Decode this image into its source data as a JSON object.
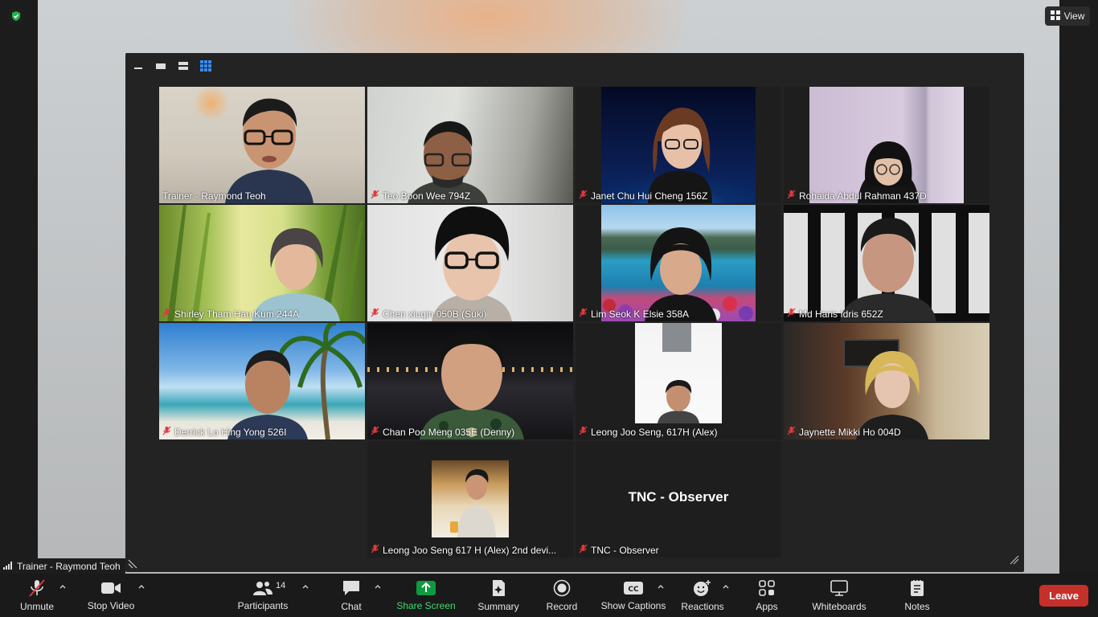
{
  "top": {
    "view_label": "View"
  },
  "gallery": {
    "observer_title": "TNC - Observer",
    "tiles": [
      {
        "name": "Trainer - Raymond Teoh",
        "muted": false
      },
      {
        "name": "Teo Boon Wee 794Z",
        "muted": true
      },
      {
        "name": "Janet Chu Hui Cheng 156Z",
        "muted": true
      },
      {
        "name": "Rohaida Abdul Rahman 437D",
        "muted": true
      },
      {
        "name": "Shirley Tham Hau Kum 244A",
        "muted": true
      },
      {
        "name": "Chen xiuqin 050B (Suki)",
        "muted": true
      },
      {
        "name": "Lim Seok K Elsie 358A",
        "muted": true
      },
      {
        "name": "Md Haris Idris 652Z",
        "muted": true
      },
      {
        "name": "Derrick Lo Hing Yong 526I",
        "muted": true
      },
      {
        "name": "Chan Poo Meng 035E (Denny)",
        "muted": true
      },
      {
        "name": "Leong Joo Seng, 617H (Alex)",
        "muted": true
      },
      {
        "name": "Jaynette Mikki Ho 004D",
        "muted": true
      },
      {
        "name": "Leong Joo Seng 617 H (Alex) 2nd devi...",
        "muted": true
      },
      {
        "name": "TNC - Observer",
        "muted": true
      }
    ]
  },
  "presenter_badge": "Trainer - Raymond Teoh",
  "toolbar": {
    "unmute": "Unmute",
    "stop_video": "Stop Video",
    "participants": "Participants",
    "participants_count": "14",
    "chat": "Chat",
    "share_screen": "Share Screen",
    "summary": "Summary",
    "record": "Record",
    "show_captions": "Show Captions",
    "reactions": "Reactions",
    "apps": "Apps",
    "whiteboards": "Whiteboards",
    "notes": "Notes",
    "leave": "Leave",
    "share_color": "#0e9a3e",
    "leave_color": "#c6302b"
  }
}
